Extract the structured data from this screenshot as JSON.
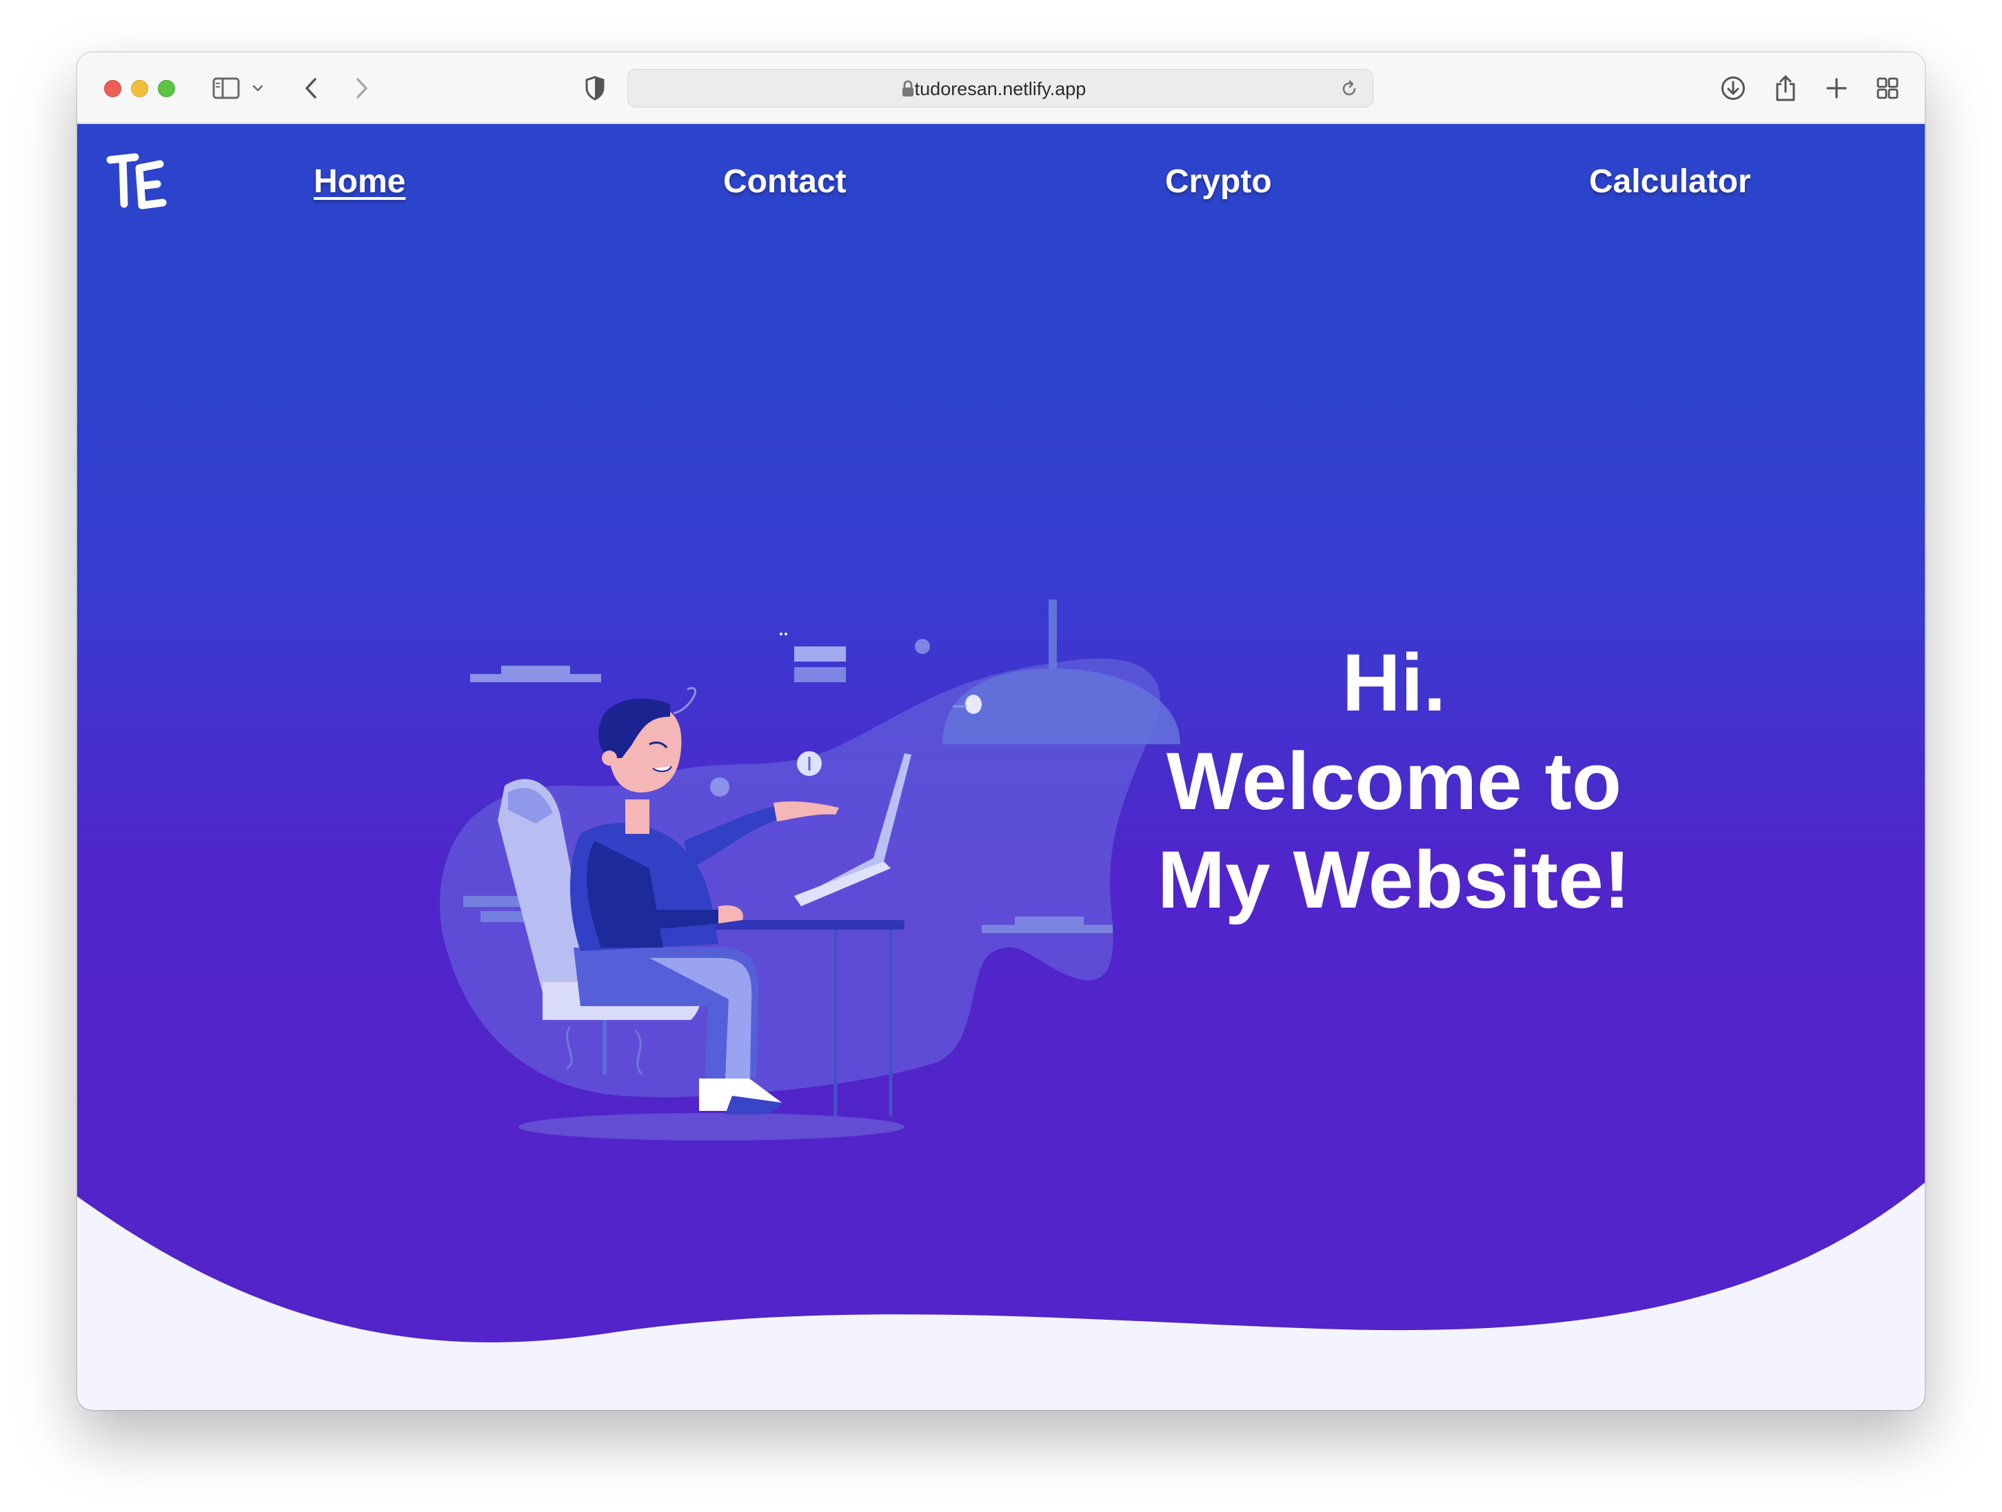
{
  "browser": {
    "url": "tudoresan.netlify.app",
    "icons": [
      "sidebar-icon",
      "chevron-down-icon",
      "back-icon",
      "forward-icon",
      "shield-icon",
      "lock-icon",
      "reload-icon",
      "download-icon",
      "share-icon",
      "new-tab-icon",
      "tab-overview-icon"
    ]
  },
  "site": {
    "logo_text": "TE",
    "nav": [
      {
        "label": "Home",
        "active": true
      },
      {
        "label": "Contact",
        "active": false
      },
      {
        "label": "Crypto",
        "active": false
      },
      {
        "label": "Calculator",
        "active": false
      }
    ],
    "hero": {
      "line1": "Hi.",
      "line2": "Welcome to",
      "line3": "My Website!"
    }
  },
  "colors": {
    "gradient_top": "#2c43cb",
    "gradient_bottom": "#5324c9",
    "wave_fill": "#f3f4fd",
    "text": "#ffffff"
  }
}
